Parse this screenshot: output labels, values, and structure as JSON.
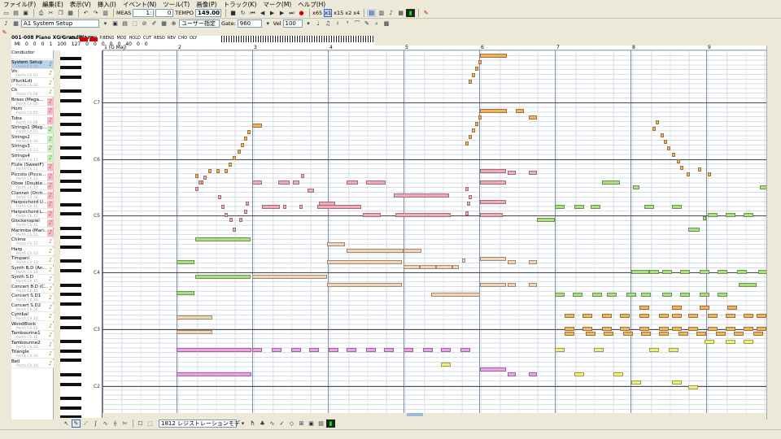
{
  "menu": [
    "ファイル(F)",
    "編集(E)",
    "表示(V)",
    "挿入(I)",
    "イベント(N)",
    "ツール(T)",
    "画像(P)",
    "トラック(K)",
    "マーク(M)",
    "ヘルプ(H)"
  ],
  "toolbar": {
    "meas_label": "MEAS",
    "measure": "1:",
    "tick": "0",
    "tempo_label": "TEMPO",
    "tempo": "149.00",
    "zoom_labels": [
      "x65",
      "x1",
      "x15",
      "x2",
      "x4"
    ],
    "track_select": "A1 System Setup",
    "mode_select": "ユーザー指定",
    "gate_label": "Gate:",
    "gate": "960",
    "vel_label": "Vel",
    "vel": "100",
    "accent_color": "#d00000"
  },
  "status": {
    "instrument": "001-008 Piano XG GrandPiano",
    "headers": [
      "PG",
      "VOL",
      "EXP",
      "PAN",
      "P.BEND",
      "MOD",
      "HOLD",
      "CUT",
      "RESO",
      "REV",
      "CHO",
      "DLY"
    ],
    "ch_label": "MI",
    "row_values": [
      "0",
      "0",
      "0",
      "1",
      "100",
      "127",
      "0",
      "0",
      "0",
      "0",
      "0",
      "40",
      "0",
      "0"
    ]
  },
  "ruler": {
    "bars": [
      {
        "num": "1 (G Maj)"
      },
      {
        "num": "2"
      },
      {
        "num": "3"
      },
      {
        "num": "4"
      },
      {
        "num": "5"
      },
      {
        "num": "6"
      },
      {
        "num": "7"
      },
      {
        "num": "8"
      },
      {
        "num": "9"
      }
    ]
  },
  "piano_labels": [
    "C7",
    "C6",
    "C5",
    "C4",
    "C3",
    "C2"
  ],
  "tracks": [
    {
      "name": "Conductor",
      "port": ""
    },
    {
      "name": "System Setup",
      "port": "PortA Ch.01",
      "selected": true
    },
    {
      "name": "Vn",
      "port": "PortA Ch.01"
    },
    {
      "name": "(PluckLd)",
      "port": "PortA Ch.02"
    },
    {
      "name": "Ch",
      "port": "PortA Ch.04"
    },
    {
      "name": "Brass (Mega...",
      "port": "PortA Ch.05"
    },
    {
      "name": "Horn",
      "port": "PortA Ch.05"
    },
    {
      "name": "Tuba",
      "port": "PortA Ch.06"
    },
    {
      "name": "Strings1 (Meg...",
      "port": "PortA Ch.07"
    },
    {
      "name": "Strings2",
      "port": "PortA Ch.10"
    },
    {
      "name": "Strings3",
      "port": "PortA Ch.11"
    },
    {
      "name": "Strings4",
      "port": "PortA Ch.11"
    },
    {
      "name": "Flute (SweetF)",
      "port": "PortA Ch.11"
    },
    {
      "name": "Piccolo (Picco...",
      "port": "PortA Ch.12"
    },
    {
      "name": "Oboe (Double...",
      "port": "PortA Ch.13"
    },
    {
      "name": "Clarinet (Orch...",
      "port": "PortA Ch.16"
    },
    {
      "name": "Harpsichord U...",
      "port": "PortA Ch.12"
    },
    {
      "name": "Harpsichord L...",
      "port": "PortA Ch.13"
    },
    {
      "name": "Glockenspiel",
      "port": "PortA Ch.16"
    },
    {
      "name": "Marimba (Mari...",
      "port": "PortA Ch.12"
    },
    {
      "name": "Chime",
      "port": "PortA Ch.12"
    },
    {
      "name": "Harp",
      "port": "PortA Ch.13"
    },
    {
      "name": "Timpani",
      "port": "PortA Ch.13"
    },
    {
      "name": "Synth B.D (An...",
      "port": "PortA Ch.14"
    },
    {
      "name": "Synth S.D",
      "port": "PortA Ch.15"
    },
    {
      "name": "Concert B.D (C...",
      "port": "PortA Ch.16"
    },
    {
      "name": "Concert S.D1",
      "port": "PortA Ch.16"
    },
    {
      "name": "Concert S.D2",
      "port": "PortA Ch.16"
    },
    {
      "name": "Cymbal",
      "port": "PortA Ch.16"
    },
    {
      "name": "WoodBlock",
      "port": "PortA Ch.16"
    },
    {
      "name": "Tambourine1",
      "port": "PortA Ch.16"
    },
    {
      "name": "Tambourine2",
      "port": "PortA Ch.16"
    },
    {
      "name": "Triangle",
      "port": "PortA Ch.16"
    },
    {
      "name": "Bell",
      "port": "PortA Ch.16"
    }
  ],
  "colors": {
    "orange": "#f5b25a",
    "pink": "#f4a9b7",
    "green": "#a8e07e",
    "tan": "#f2d5b4",
    "magenta": "#f0a0e8",
    "yellow": "#f3f07a",
    "purple": "#d9b3ea",
    "blueish": "#9fd0f0"
  },
  "bottom_tool": {
    "select_value": "1812 レジストレーションモデ"
  }
}
